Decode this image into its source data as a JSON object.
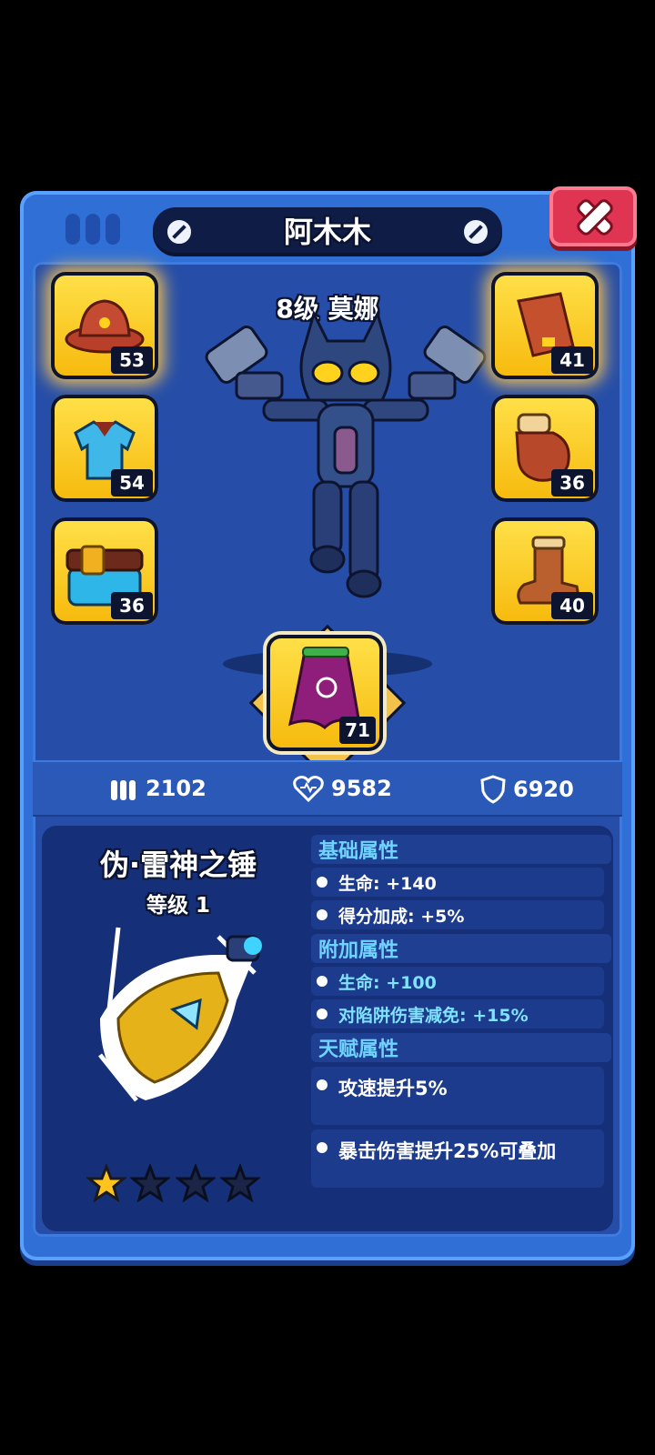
{
  "header": {
    "title": "阿木木"
  },
  "hero": {
    "level_label": "8级 莫娜"
  },
  "equipment": {
    "hat": {
      "icon": "cowboy-hat-icon",
      "level": "53"
    },
    "shirt": {
      "icon": "shirt-icon",
      "level": "54"
    },
    "belt": {
      "icon": "belt-icon",
      "level": "36"
    },
    "armguard": {
      "icon": "armguard-icon",
      "level": "41"
    },
    "glove": {
      "icon": "glove-icon",
      "level": "36"
    },
    "boot": {
      "icon": "boot-icon",
      "level": "40"
    },
    "cape": {
      "icon": "cape-icon",
      "level": "71"
    }
  },
  "stats": {
    "ammo": "2102",
    "health": "9582",
    "defense": "6920"
  },
  "item": {
    "name": "伪·雷神之锤",
    "level_label": "等级 1",
    "stars": {
      "filled": 1,
      "total": 4
    }
  },
  "attributes": {
    "base_header": "基础属性",
    "base": [
      "生命: +140",
      "得分加成: +5%"
    ],
    "extra_header": "附加属性",
    "extra": [
      "生命: +100",
      "对陷阱伤害减免: +15%"
    ],
    "talent_header": "天赋属性",
    "talent": [
      "攻速提升5%",
      "暴击伤害提升25%可叠加"
    ]
  },
  "colors": {
    "panel": "#2f6fd6",
    "slot": "#ffd21e",
    "accent_cyan": "#6fd3ff",
    "close": "#e03453"
  }
}
